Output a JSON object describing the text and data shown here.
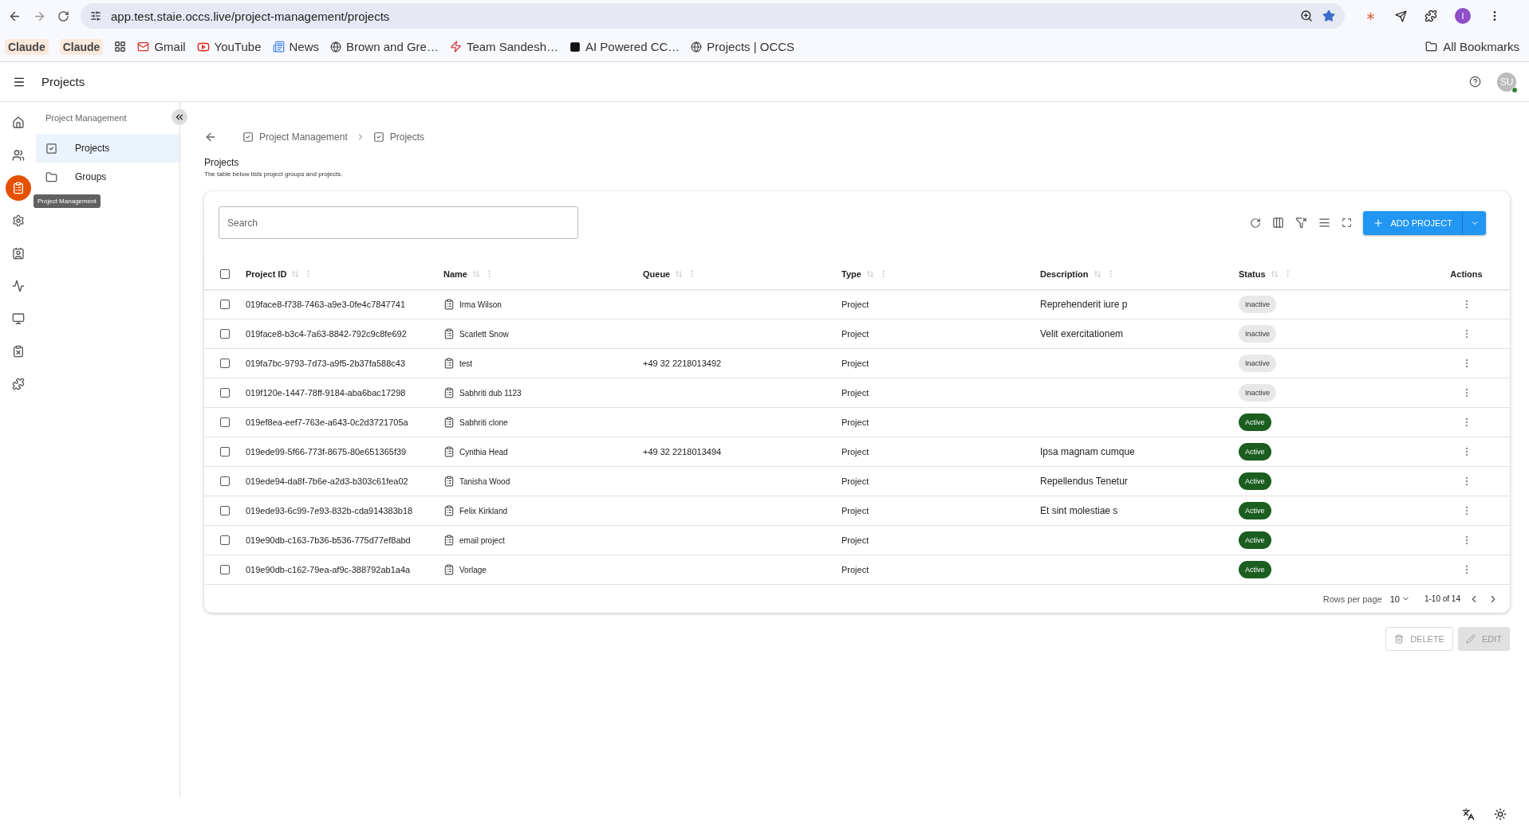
{
  "browser": {
    "url": "app.test.staie.occs.live/project-management/projects",
    "bookmarks": [
      {
        "kind": "chip",
        "label": "Claude"
      },
      {
        "kind": "chip",
        "label": "Claude"
      },
      {
        "kind": "apps"
      },
      {
        "kind": "mail",
        "label": "Gmail"
      },
      {
        "kind": "video",
        "label": "YouTube"
      },
      {
        "kind": "news",
        "label": "News"
      },
      {
        "kind": "globe",
        "label": "Brown and Gre…"
      },
      {
        "kind": "brand",
        "label": "Team Sandesh…"
      },
      {
        "kind": "dark",
        "label": "AI Powered CC…"
      },
      {
        "kind": "globe",
        "label": "Projects | OCCS"
      }
    ],
    "all_bookmarks": "All Bookmarks",
    "profile_initial": "I"
  },
  "app_header": {
    "title": "Projects",
    "avatar": "SU"
  },
  "rail": [
    {
      "kind": "home",
      "selected": false
    },
    {
      "kind": "people",
      "selected": false
    },
    {
      "kind": "clipboard",
      "selected": true
    },
    {
      "kind": "gear",
      "selected": false
    },
    {
      "kind": "contact",
      "selected": false
    },
    {
      "kind": "pulse",
      "selected": false
    },
    {
      "kind": "monitor",
      "selected": false
    },
    {
      "kind": "alert",
      "selected": false
    },
    {
      "kind": "puzzle",
      "selected": false
    }
  ],
  "tooltip": "Project Management",
  "nav": {
    "section": "Project Management",
    "items": [
      {
        "kind": "check",
        "label": "Projects",
        "selected": true
      },
      {
        "kind": "folder",
        "label": "Groups",
        "selected": false
      }
    ]
  },
  "breadcrumbs": [
    "Project Management",
    "Projects"
  ],
  "page": {
    "title": "Projects",
    "subtitle": "The table below lists project groups and projects."
  },
  "search": {
    "placeholder": "Search"
  },
  "add_button": "ADD PROJECT",
  "table": {
    "all_checked": false,
    "columns": [
      "Project ID",
      "Name",
      "Queue",
      "Type",
      "Description",
      "Status",
      "Actions"
    ],
    "rows": [
      {
        "id": "019face8-f738-7463-a9e3-0fe4c7847741",
        "name": "Irma Wilson",
        "queue": "",
        "type": "Project",
        "description": "Reprehenderit iure p",
        "status": "Inactive",
        "active": false,
        "checked": false
      },
      {
        "id": "019face8-b3c4-7a63-8842-792c9c8fe692",
        "name": "Scarlett Snow",
        "queue": "",
        "type": "Project",
        "description": "Velit exercitationem",
        "status": "Inactive",
        "active": false,
        "checked": false
      },
      {
        "id": "019fa7bc-9793-7d73-a9f5-2b37fa588c43",
        "name": "test",
        "queue": "+49 32 2218013492",
        "type": "Project",
        "description": "",
        "status": "Inactive",
        "active": false,
        "checked": false
      },
      {
        "id": "019f120e-1447-78ff-9184-aba6bac17298",
        "name": "Sabhriti dub 1123",
        "queue": "",
        "type": "Project",
        "description": "",
        "status": "Inactive",
        "active": false,
        "checked": false
      },
      {
        "id": "019ef8ea-eef7-763e-a643-0c2d3721705a",
        "name": "Sabhriti clone",
        "queue": "",
        "type": "Project",
        "description": "",
        "status": "Active",
        "active": true,
        "checked": false
      },
      {
        "id": "019ede99-5f66-773f-8675-80e651365f39",
        "name": "Cynthia Head",
        "queue": "+49 32 2218013494",
        "type": "Project",
        "description": "Ipsa magnam cumque",
        "status": "Active",
        "active": true,
        "checked": false
      },
      {
        "id": "019ede94-da8f-7b6e-a2d3-b303c61fea02",
        "name": "Tanisha Wood",
        "queue": "",
        "type": "Project",
        "description": "Repellendus Tenetur",
        "status": "Active",
        "active": true,
        "checked": false
      },
      {
        "id": "019ede93-6c99-7e93-832b-cda914383b18",
        "name": "Felix Kirkland",
        "queue": "",
        "type": "Project",
        "description": "Et sint molestiae s",
        "status": "Active",
        "active": true,
        "checked": false
      },
      {
        "id": "019e90db-c163-7b36-b536-775d77ef8abd",
        "name": "email project",
        "queue": "",
        "type": "Project",
        "description": "",
        "status": "Active",
        "active": true,
        "checked": false
      },
      {
        "id": "019e90db-c162-79ea-af9c-388792ab1a4a",
        "name": "Vorlage",
        "queue": "",
        "type": "Project",
        "description": "",
        "status": "Active",
        "active": true,
        "checked": false
      }
    ]
  },
  "pagination": {
    "rows_per_page_label": "Rows per page",
    "rows_per_page": "10",
    "range": "1-10 of 14"
  },
  "actions": [
    {
      "kind": "delete",
      "label": "DELETE",
      "disabled": true
    },
    {
      "kind": "edit",
      "label": "EDIT",
      "disabled": true
    }
  ]
}
